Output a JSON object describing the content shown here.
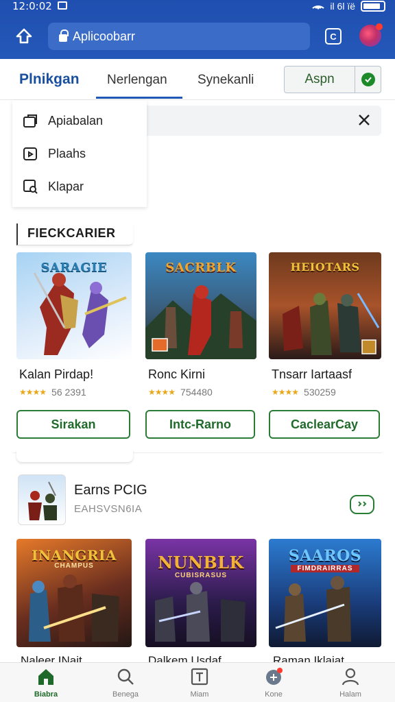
{
  "status_bar": {
    "time": "12:0:02",
    "right_text": "il 6l ïë"
  },
  "browser": {
    "url": "Aplicoobarr",
    "tabs_count": "C"
  },
  "nav": {
    "brand": "Plnikgan",
    "tabs": [
      {
        "label": "Nerlengan"
      },
      {
        "label": "Synekanli"
      }
    ],
    "sign_in_label": "Aspn"
  },
  "dropdown": {
    "items": [
      {
        "label": "Apiabalan",
        "icon": "tab-add-icon"
      },
      {
        "label": "Plaahs",
        "icon": "play-square-icon"
      },
      {
        "label": "Klapar",
        "icon": "image-search-icon"
      }
    ]
  },
  "section1": {
    "label": "FIECKCARIER",
    "games": [
      {
        "title": "Kalan Pirdap!",
        "rating_text": "56 2391",
        "button": "Sirakan",
        "art_logo": "SARAGIE",
        "art_colors": [
          "#8ec6ef",
          "#dce9f6",
          "#ffffff"
        ]
      },
      {
        "title": "Ronc Kirni",
        "rating_text": "754480",
        "button": "Intc-Rarno",
        "art_logo": "SACRBLK",
        "art_colors": [
          "#3b88c2",
          "#3a5c7a",
          "#1f2b22"
        ]
      },
      {
        "title": "Tnsarr Iartaasf",
        "rating_text": "530259",
        "button": "CaclearCay",
        "art_logo": "HEIOTARS",
        "art_colors": [
          "#6e3a1e",
          "#a8532a",
          "#2b1a18"
        ]
      }
    ]
  },
  "section2": {
    "app_title": "Earns PCIG",
    "app_subtitle": "EAHSVSN6IA",
    "games": [
      {
        "title": "Naleer INait",
        "art_logo": "INANGRIA",
        "sub": "CHAMPUS",
        "art_colors": [
          "#d9652a",
          "#6a2e1f",
          "#231714"
        ]
      },
      {
        "title": "Dalkem Usdaf",
        "art_logo": "NUNBLK",
        "sub": "CUBISRASUS",
        "art_colors": [
          "#5f2a8a",
          "#2a1b4a",
          "#160f22"
        ]
      },
      {
        "title": "Raman Iklaiat",
        "art_logo": "SAAROS",
        "sub": "FIMDRAIRRAS",
        "art_colors": [
          "#2c7bd0",
          "#1a3c7a",
          "#0f1a33"
        ]
      }
    ]
  },
  "bottom_nav": {
    "items": [
      {
        "label": "Biabra",
        "icon": "home-icon"
      },
      {
        "label": "Benega",
        "icon": "search-icon"
      },
      {
        "label": "Miam",
        "icon": "library-icon"
      },
      {
        "label": "Kone",
        "icon": "games-icon"
      },
      {
        "label": "Halam",
        "icon": "profile-icon"
      }
    ]
  }
}
